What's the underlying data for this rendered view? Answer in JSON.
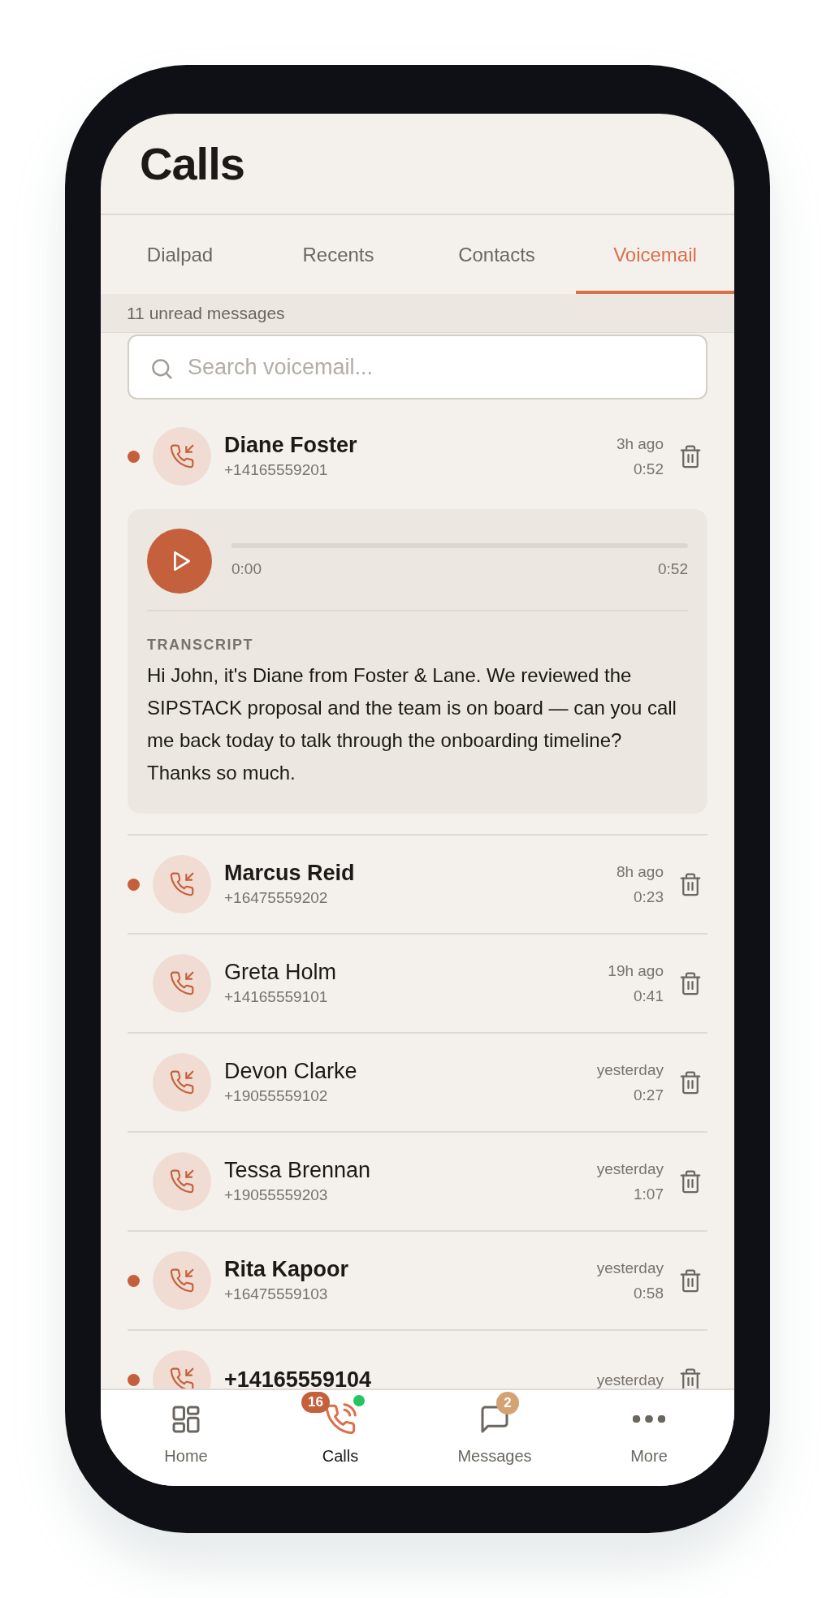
{
  "header": {
    "title": "Calls"
  },
  "tabs": [
    {
      "label": "Dialpad",
      "selected": false
    },
    {
      "label": "Recents",
      "selected": false
    },
    {
      "label": "Contacts",
      "selected": false
    },
    {
      "label": "Voicemail",
      "selected": true
    }
  ],
  "summary": "11 unread messages",
  "search": {
    "placeholder": "Search voicemail..."
  },
  "voicemails": [
    {
      "name": "Diane Foster",
      "number": "+14165559201",
      "time": "3h ago",
      "duration": "0:52",
      "unread": true,
      "expanded": true,
      "player": {
        "current": "0:00",
        "total": "0:52",
        "level": 0
      },
      "transcript_label": "TRANSCRIPT",
      "transcript": "Hi John, it's Diane from Foster & Lane. We reviewed the SIPSTACK proposal and the team is on board — can you call me back today to talk through the onboarding timeline? Thanks so much."
    },
    {
      "name": "Marcus Reid",
      "number": "+16475559202",
      "time": "8h ago",
      "duration": "0:23",
      "unread": true,
      "expanded": false
    },
    {
      "name": "Greta Holm",
      "number": "+14165559101",
      "time": "19h ago",
      "duration": "0:41",
      "unread": false,
      "expanded": false
    },
    {
      "name": "Devon Clarke",
      "number": "+19055559102",
      "time": "yesterday",
      "duration": "0:27",
      "unread": false,
      "expanded": false
    },
    {
      "name": "Tessa Brennan",
      "number": "+19055559203",
      "time": "yesterday",
      "duration": "1:07",
      "unread": false,
      "expanded": false
    },
    {
      "name": "Rita Kapoor",
      "number": "+16475559103",
      "time": "yesterday",
      "duration": "0:58",
      "unread": true,
      "expanded": false
    },
    {
      "name": "+14165559104",
      "time": "yesterday",
      "unread": true,
      "expanded": false
    }
  ],
  "bottom_nav": [
    {
      "kind": "home",
      "label": "Home",
      "selected": false
    },
    {
      "kind": "calls",
      "label": "Calls",
      "selected": true,
      "badge": "16",
      "online": true
    },
    {
      "kind": "messages",
      "label": "Messages",
      "selected": false,
      "badge": "2"
    },
    {
      "kind": "more",
      "label": "More",
      "selected": false
    }
  ]
}
